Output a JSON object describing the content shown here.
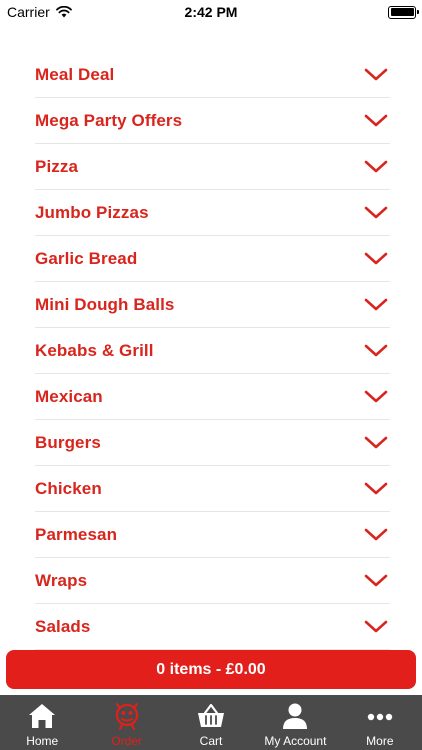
{
  "status_bar": {
    "carrier": "Carrier",
    "time": "2:42 PM"
  },
  "categories": [
    {
      "label": "Meal Deal"
    },
    {
      "label": "Mega Party Offers"
    },
    {
      "label": "Pizza"
    },
    {
      "label": "Jumbo Pizzas"
    },
    {
      "label": "Garlic Bread"
    },
    {
      "label": "Mini Dough Balls"
    },
    {
      "label": "Kebabs & Grill"
    },
    {
      "label": "Mexican"
    },
    {
      "label": "Burgers"
    },
    {
      "label": "Chicken"
    },
    {
      "label": "Parmesan"
    },
    {
      "label": "Wraps"
    },
    {
      "label": "Salads"
    }
  ],
  "cart": {
    "label": "0 items - £0.00"
  },
  "tabs": [
    {
      "label": "Home",
      "icon": "home-icon"
    },
    {
      "label": "Order",
      "icon": "order-icon",
      "active": true
    },
    {
      "label": "Cart",
      "icon": "basket-icon"
    },
    {
      "label": "My Account",
      "icon": "person-icon"
    },
    {
      "label": "More",
      "icon": "more-icon"
    }
  ],
  "colors": {
    "accent": "#d8251d",
    "cart_bar": "#e21f1b",
    "tab_bar": "#4a4a4a"
  }
}
